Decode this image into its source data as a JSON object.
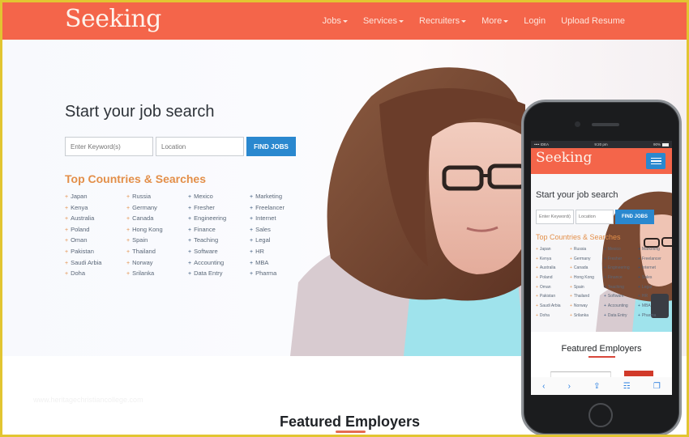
{
  "brand": {
    "logo": "Seeking",
    "accent": "#f4654a",
    "button_color": "#2a88cf",
    "heading_color": "#e38f49"
  },
  "nav": {
    "items": [
      {
        "label": "Jobs",
        "dropdown": true
      },
      {
        "label": "Services",
        "dropdown": true
      },
      {
        "label": "Recruiters",
        "dropdown": true
      },
      {
        "label": "More",
        "dropdown": true
      },
      {
        "label": "Login",
        "dropdown": false
      },
      {
        "label": "Upload Resume",
        "dropdown": false
      }
    ]
  },
  "hero": {
    "title": "Start your job search",
    "keyword_placeholder": "Enter Keyword(s)",
    "location_placeholder": "Location",
    "find_button": "FIND JOBS",
    "section_title": "Top Countries & Searches",
    "columns": [
      [
        "Japan",
        "Kenya",
        "Australia",
        "Poland",
        "Oman",
        "Pakistan",
        "Saudi Arbia",
        "Doha"
      ],
      [
        "Russia",
        "Germany",
        "Canada",
        "Hong Kong",
        "Spain",
        "Thailand",
        "Norway",
        "Srilanka"
      ],
      [
        "Mexico",
        "Fresher",
        "Engineering",
        "Finance",
        "Teaching",
        "Software",
        "Accounting",
        "Data Entry"
      ],
      [
        "Marketing",
        "Freelancer",
        "Internet",
        "Sales",
        "Legal",
        "HR",
        "MBA",
        "Pharma"
      ]
    ]
  },
  "watermark": "www.heritagechristiancollege.com",
  "featured": {
    "title": "Featured Employers"
  },
  "phone": {
    "status": {
      "carrier": "•••• IDEA",
      "time": "9:20 pm",
      "battery": "90%"
    },
    "logo": "Seeking",
    "title": "Start your job search",
    "keyword_placeholder": "Enter Keyword(s)",
    "location_placeholder": "Location",
    "find_button": "FIND JOBS",
    "section_title": "Top Countries & Searches",
    "featured_title": "Featured Employers",
    "toolbar": [
      "‹",
      "›",
      "⇪",
      "📖",
      "❐"
    ]
  }
}
